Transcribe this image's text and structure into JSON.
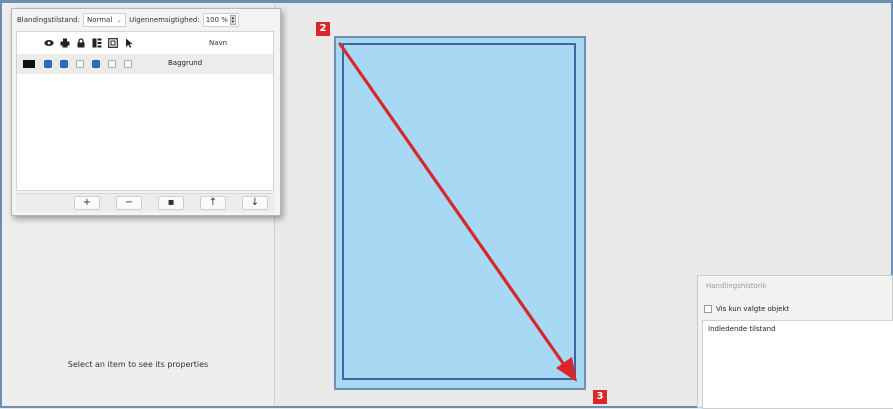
{
  "layers": {
    "blend_label": "Blandingstilstand:",
    "blend_value": "Normal",
    "opacity_label": "Uigennemsigtighed:",
    "opacity_value": "100 %",
    "name_column": "Navn",
    "rows": [
      {
        "name": "Baggrund",
        "color": "#111111"
      }
    ],
    "buttons": {
      "add": "+",
      "remove": "−",
      "duplicate": "▪",
      "up": "↑",
      "down": "↓"
    }
  },
  "properties": {
    "empty_text": "Select an item to see its properties"
  },
  "markers": {
    "start": "2",
    "end": "3"
  },
  "history": {
    "title": "Handlingshistorik",
    "checkbox_label": "Vis kun valgte objekt",
    "items": [
      "Indledende tilstand"
    ]
  },
  "colors": {
    "accent": "#2a73c6",
    "marker": "#d9262a",
    "page_fill": "#a7d9f5",
    "arrow": "#d9262a"
  }
}
